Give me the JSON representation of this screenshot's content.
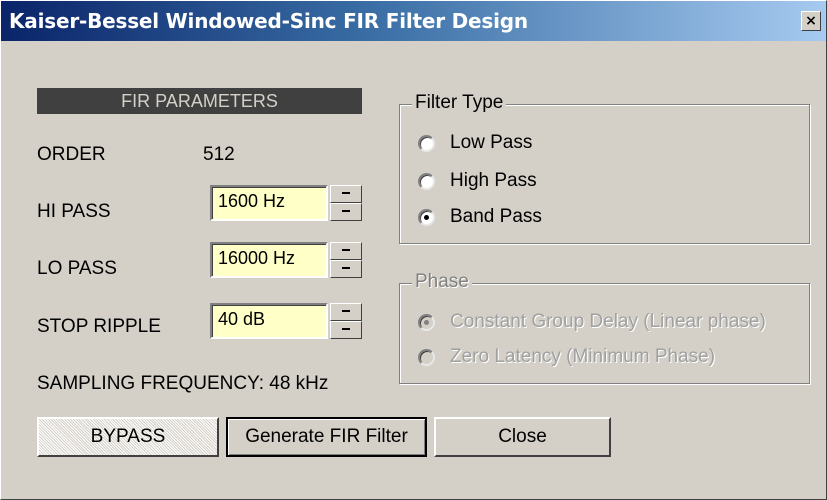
{
  "window": {
    "title": "Kaiser-Bessel Windowed-Sinc FIR Filter Design",
    "close_glyph": "×"
  },
  "params": {
    "header": "FIR PARAMETERS",
    "order_label": "ORDER",
    "order_value": "512",
    "hipass_label": "HI PASS",
    "hipass_value": "1600 Hz",
    "lopass_label": "LO PASS",
    "lopass_value": "16000 Hz",
    "stopripple_label": "STOP RIPPLE",
    "stopripple_value": "40 dB",
    "sampling": "SAMPLING FREQUENCY: 48 kHz"
  },
  "filter_type": {
    "title": "Filter Type",
    "options": [
      "Low Pass",
      "High Pass",
      "Band Pass"
    ],
    "selected": "Band Pass"
  },
  "phase": {
    "title": "Phase",
    "options": [
      "Constant Group Delay (Linear phase)",
      "Zero Latency (Minimum Phase)"
    ],
    "selected": "Constant Group Delay (Linear phase)",
    "enabled": false
  },
  "buttons": {
    "bypass": "BYPASS",
    "generate": "Generate FIR Filter",
    "close": "Close"
  },
  "colors": {
    "face": "#d4d0c8",
    "input_bg": "#ffffc8",
    "title_start": "#0a246a",
    "title_end": "#a6caf0",
    "header_bar": "#404040"
  }
}
